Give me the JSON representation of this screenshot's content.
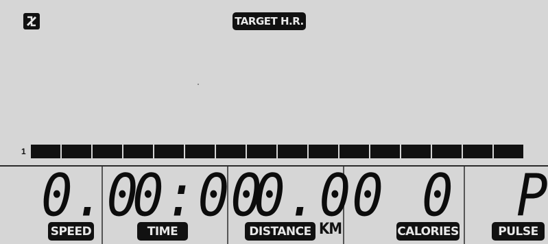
{
  "display": {
    "target_label": "TARGET H.R.",
    "bar_index": "1",
    "segments": 16
  },
  "readouts": {
    "speed": {
      "value": "0.0",
      "label": "SPEED"
    },
    "time": {
      "value": "0:00",
      "label": "TIME"
    },
    "distance": {
      "value": "0.00",
      "label": "DISTANCE",
      "unit": "KM"
    },
    "calories": {
      "value": "0",
      "label": "CALORIES"
    },
    "pulse": {
      "value": "P",
      "label": "PULSE"
    }
  },
  "icons": {
    "corner": "program-indicator-icon"
  },
  "colors": {
    "background": "#d6d6d6",
    "foreground": "#111111"
  }
}
